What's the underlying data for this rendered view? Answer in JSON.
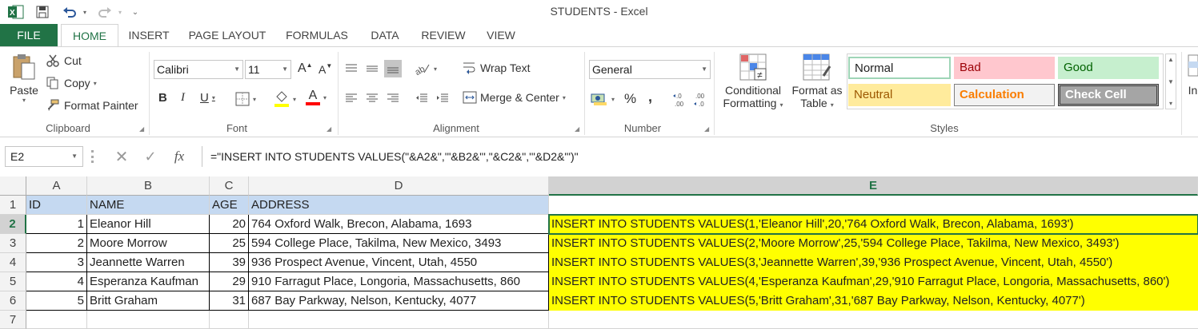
{
  "window": {
    "title": "STUDENTS - Excel"
  },
  "quick_access": {
    "app_icon": "excel-logo-icon",
    "save_icon": "save-icon",
    "undo_icon": "undo-icon",
    "redo_icon": "redo-icon",
    "customize_icon": "customize-icon"
  },
  "tabs": [
    {
      "label": "FILE"
    },
    {
      "label": "HOME"
    },
    {
      "label": "INSERT"
    },
    {
      "label": "PAGE LAYOUT"
    },
    {
      "label": "FORMULAS"
    },
    {
      "label": "DATA"
    },
    {
      "label": "REVIEW"
    },
    {
      "label": "VIEW"
    }
  ],
  "ribbon": {
    "clipboard": {
      "label": "Clipboard",
      "paste": "Paste",
      "cut": "Cut",
      "copy": "Copy",
      "format_painter": "Format Painter"
    },
    "font": {
      "label": "Font",
      "name": "Calibri",
      "size": "11",
      "bold": "B",
      "italic": "I",
      "underline": "U",
      "grow": "A",
      "shrink": "A",
      "font_color_letter": "A"
    },
    "alignment": {
      "label": "Alignment",
      "wrap_text": "Wrap Text",
      "merge_center": "Merge & Center"
    },
    "number": {
      "label": "Number",
      "format": "General",
      "percent": "%",
      "comma": ",",
      "inc_decimal": "←.0\n.00",
      "dec_decimal": ".00\n→.0"
    },
    "styles": {
      "label": "Styles",
      "conditional_formatting_1": "Conditional",
      "conditional_formatting_2": "Formatting",
      "format_as_table_1": "Format as",
      "format_as_table_2": "Table",
      "cells": [
        {
          "label": "Normal",
          "bg": "#ffffff",
          "color": "#000000"
        },
        {
          "label": "Bad",
          "bg": "#ffc7ce",
          "color": "#9c0006"
        },
        {
          "label": "Good",
          "bg": "#c6efce",
          "color": "#006100"
        },
        {
          "label": "Neutral",
          "bg": "#ffeb9c",
          "color": "#9c5700"
        },
        {
          "label": "Calculation",
          "bg": "#f2f2f2",
          "color": "#fa7d00"
        },
        {
          "label": "Check Cell",
          "bg": "#a5a5a5",
          "color": "#ffffff"
        }
      ]
    },
    "cells_partial": "In"
  },
  "formula_bar": {
    "name_box": "E2",
    "cancel_icon": "cancel-icon",
    "enter_icon": "enter-icon",
    "fx": "fx",
    "formula": "=\"INSERT INTO STUDENTS VALUES(\"&A2&\",'\"&B2&\"',\"&C2&\",'\"&D2&\"')\""
  },
  "sheet": {
    "columns": [
      "A",
      "B",
      "C",
      "D",
      "E"
    ],
    "rows": [
      "1",
      "2",
      "3",
      "4",
      "5",
      "6",
      "7"
    ],
    "header_row": [
      "ID",
      "NAME",
      "AGE",
      "ADDRESS"
    ],
    "data": [
      {
        "id": "1",
        "name": "Eleanor Hill",
        "age": "20",
        "address": "764 Oxford Walk, Brecon, Alabama, 1693",
        "sql": "INSERT INTO STUDENTS VALUES(1,'Eleanor Hill',20,'764 Oxford Walk, Brecon, Alabama, 1693')"
      },
      {
        "id": "2",
        "name": "Moore Morrow",
        "age": "25",
        "address": "594 College Place, Takilma, New Mexico, 3493",
        "sql": "INSERT INTO STUDENTS VALUES(2,'Moore Morrow',25,'594 College Place, Takilma, New Mexico, 3493')"
      },
      {
        "id": "3",
        "name": "Jeannette Warren",
        "age": "39",
        "address": "936 Prospect Avenue, Vincent, Utah, 4550",
        "sql": "INSERT INTO STUDENTS VALUES(3,'Jeannette Warren',39,'936 Prospect Avenue, Vincent, Utah, 4550')"
      },
      {
        "id": "4",
        "name": "Esperanza Kaufman",
        "age": "29",
        "address": "910 Farragut Place, Longoria, Massachusetts, 860",
        "sql": "INSERT INTO STUDENTS VALUES(4,'Esperanza Kaufman',29,'910 Farragut Place, Longoria, Massachusetts, 860')"
      },
      {
        "id": "5",
        "name": "Britt Graham",
        "age": "31",
        "address": "687 Bay Parkway, Nelson, Kentucky, 4077",
        "sql": "INSERT INTO STUDENTS VALUES(5,'Britt Graham',31,'687 Bay Parkway, Nelson, Kentucky, 4077')"
      }
    ],
    "active_cell": "E2",
    "highlight_color": "#ffff00",
    "header_fill": "#c5d9f1",
    "accent": "#217346"
  }
}
